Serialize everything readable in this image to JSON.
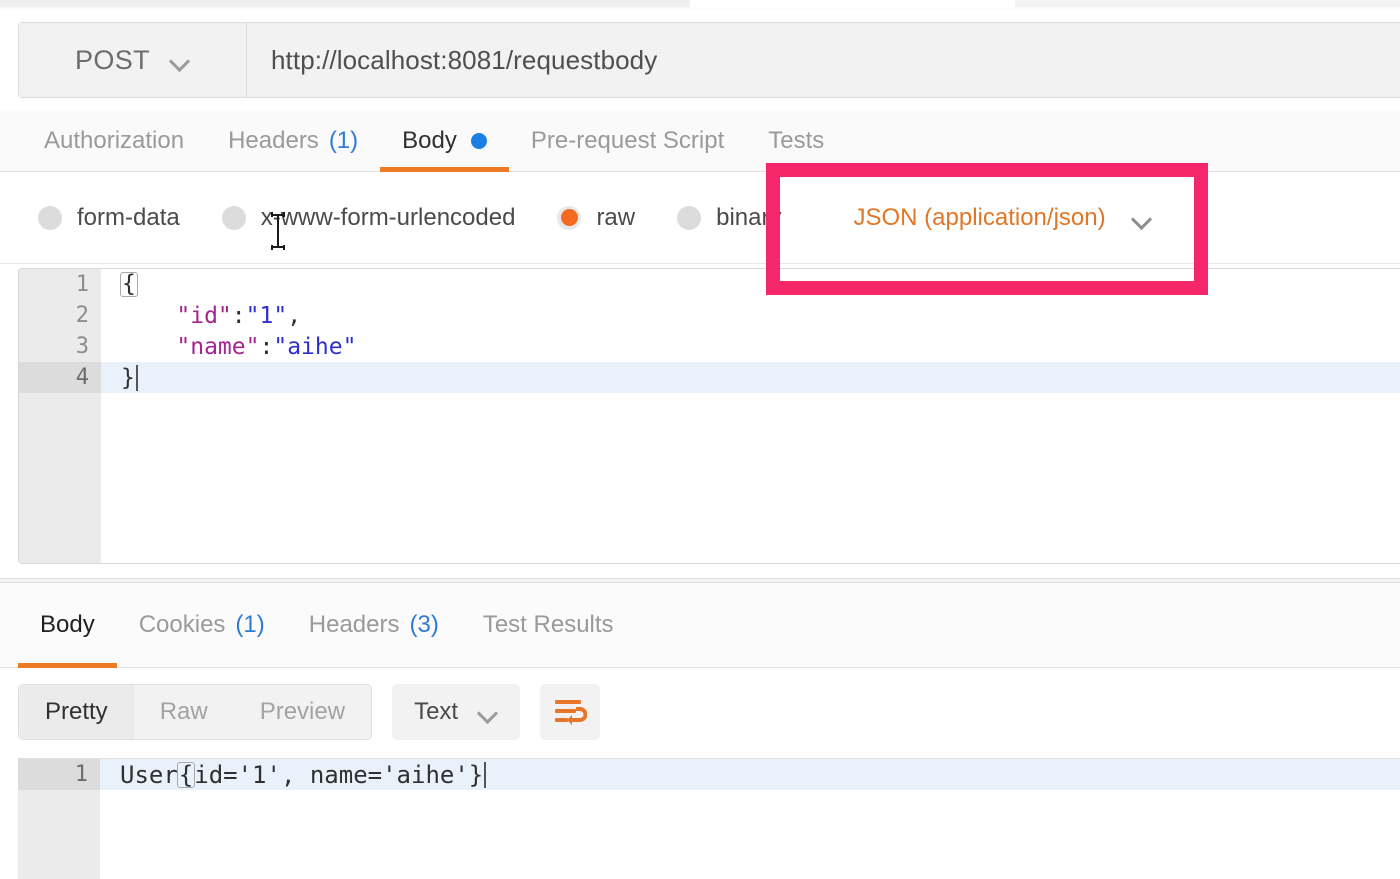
{
  "request": {
    "method": "POST",
    "method_icon": "chevron-down-icon",
    "url": "http://localhost:8081/requestbody",
    "tabs": [
      {
        "label": "Authorization",
        "count": "",
        "active": false,
        "dot": false
      },
      {
        "label": "Headers",
        "count": "(1)",
        "active": false,
        "dot": false
      },
      {
        "label": "Body",
        "count": "",
        "active": true,
        "dot": true
      },
      {
        "label": "Pre-request Script",
        "count": "",
        "active": false,
        "dot": false
      },
      {
        "label": "Tests",
        "count": "",
        "active": false,
        "dot": false
      }
    ],
    "body_types": [
      {
        "label": "form-data",
        "checked": false
      },
      {
        "label": "x-www-form-urlencoded",
        "checked": false
      },
      {
        "label": "raw",
        "checked": true
      },
      {
        "label": "binary",
        "checked": false
      }
    ],
    "content_type": {
      "label": "JSON (application/json)",
      "icon": "chevron-down-icon"
    },
    "editor": {
      "lines": [
        {
          "num": "1",
          "foldable": true,
          "active": false
        },
        {
          "num": "2",
          "foldable": false,
          "active": false
        },
        {
          "num": "3",
          "foldable": false,
          "active": false
        },
        {
          "num": "4",
          "foldable": false,
          "active": true
        }
      ],
      "line1_brace": "{",
      "line2_key": "\"id\"",
      "line2_colon": ":",
      "line2_val": "\"1\"",
      "line2_comma": ",",
      "line3_key": "\"name\"",
      "line3_colon": ":",
      "line3_val": "\"aihe\"",
      "line4_brace": "}"
    }
  },
  "response": {
    "tabs": [
      {
        "label": "Body",
        "count": "",
        "active": true
      },
      {
        "label": "Cookies",
        "count": "(1)",
        "active": false
      },
      {
        "label": "Headers",
        "count": "(3)",
        "active": false
      },
      {
        "label": "Test Results",
        "count": "",
        "active": false
      }
    ],
    "view_modes": [
      {
        "label": "Pretty",
        "active": true
      },
      {
        "label": "Raw",
        "active": false
      },
      {
        "label": "Preview",
        "active": false
      }
    ],
    "format": {
      "label": "Text",
      "icon": "chevron-down-icon"
    },
    "wrap_button_icon": "word-wrap-icon",
    "editor": {
      "line_number": "1",
      "text_prefix": "User",
      "text_brace_open": "{",
      "text_rest": "id='1', name='aihe'}"
    }
  },
  "annotation": {
    "highlight_color": "#f5276a"
  },
  "cursor": {
    "type": "text-ibeam-cursor"
  },
  "colors": {
    "accent_orange": "#ec7b24",
    "link_blue": "#2f7bd4",
    "dot_blue": "#1a7ee5",
    "radio_orange": "#f26b21",
    "content_type_orange": "#e27627",
    "json_key_magenta": "#a5258f",
    "json_value_blue": "#2f2fd0",
    "active_line_blue": "#e9f2fb",
    "annotation_pink": "#f5276a"
  }
}
